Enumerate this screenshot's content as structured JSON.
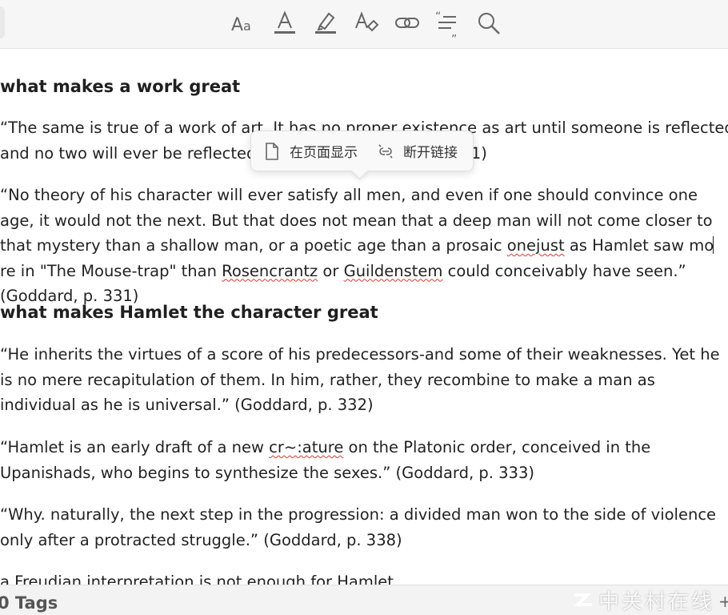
{
  "toolbar": {
    "tools": [
      "font-style",
      "text-color",
      "highlighter",
      "clear-formatting",
      "link",
      "quote",
      "search"
    ]
  },
  "note": {
    "heading1": "what makes a work great",
    "p1_lead": "“The same is true of a work of art. It has no proper existence as art until someone is reflected in it-",
    "p1_tail_start": "and no two will ever be reflected i",
    "p1_tail_end": "331)",
    "p2_a": "“No theory of his character will ever satisfy all men, and even if one should convince one age, it would not the next. But that does not mean that a deep man will not come closer to that mystery than a shallow man, or a poetic age than a prosaic ",
    "p2_sq1": "onejust",
    "p2_b": " as Hamlet saw mo",
    "p2_c": "re in \"The Mouse-trap\" than ",
    "p2_sq2": "Rosencrantz",
    "p2_d": " or ",
    "p2_sq3": "Guildenstem",
    "p2_e": " could conceivably have seen.” (Goddard, p. 331)",
    "heading2": "what makes Hamlet the character great",
    "p3": "“He inherits the virtues of a score of his predecessors-and some of their weaknesses. Yet he is no mere recapitulation of them. In him, rather, they recombine to make a man as individual as he is universal.” (Goddard, p. 332)",
    "p4_a": "“Hamlet is an early draft of a new ",
    "p4_sq1": "cr~:",
    "p4_sq2": "ature",
    "p4_b": " on the Platonic order, conceived in the Upanishads, who begins to synthesize the sexes.” (Goddard, p. 333)",
    "p5": "“Why. naturally, the next step in the progression: a divided man won to the side of violence only after a protracted struggle.” (Goddard, p. 338)",
    "p6": "a Freudian interpretation is not enough for Hamlet"
  },
  "popup": {
    "show_on_page": "在页面显示",
    "unlink": "断开链接"
  },
  "footer": {
    "tags": "0 Tags",
    "add": "+"
  },
  "watermark": "中关村在线",
  "colors": {
    "squiggle": "#d83a2f",
    "toolbar_bg": "#f6f6f6",
    "icon": "#666666"
  }
}
